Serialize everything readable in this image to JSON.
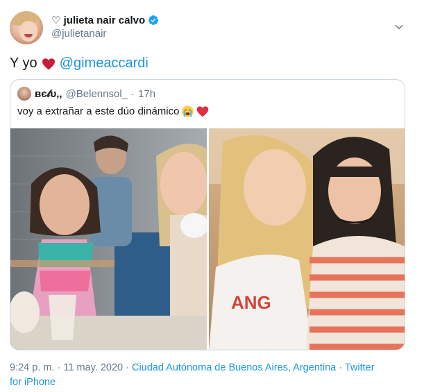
{
  "tweet": {
    "display_name": "♡ julieta nair calvo",
    "handle": "@julietanair",
    "text_prefix": "Y yo",
    "mention": "@gimeaccardi",
    "icons": [
      "verified-badge-icon",
      "chevron-down-icon",
      "red-heart-icon"
    ]
  },
  "quote": {
    "display_name": "вє𝓁υ,,",
    "handle": "@Belennsol_",
    "separator": "·",
    "time": "17h",
    "text": "voy a extrañar a este dúo dinámico",
    "emojis": [
      "crying-face-icon",
      "red-heart-icon"
    ]
  },
  "meta": {
    "time_date": "9:24 p. m. · 11 may. 2020",
    "location": "Ciudad Autónoma de Buenos Aires, Argentina",
    "separator": "·",
    "source_line1": "Twitter",
    "source_line2": "for iPhone"
  },
  "colors": {
    "accent": "#1b95e0",
    "text": "#14171a",
    "secondary": "#657786",
    "border": "#ccd6dd",
    "heart": "#e0245e"
  }
}
